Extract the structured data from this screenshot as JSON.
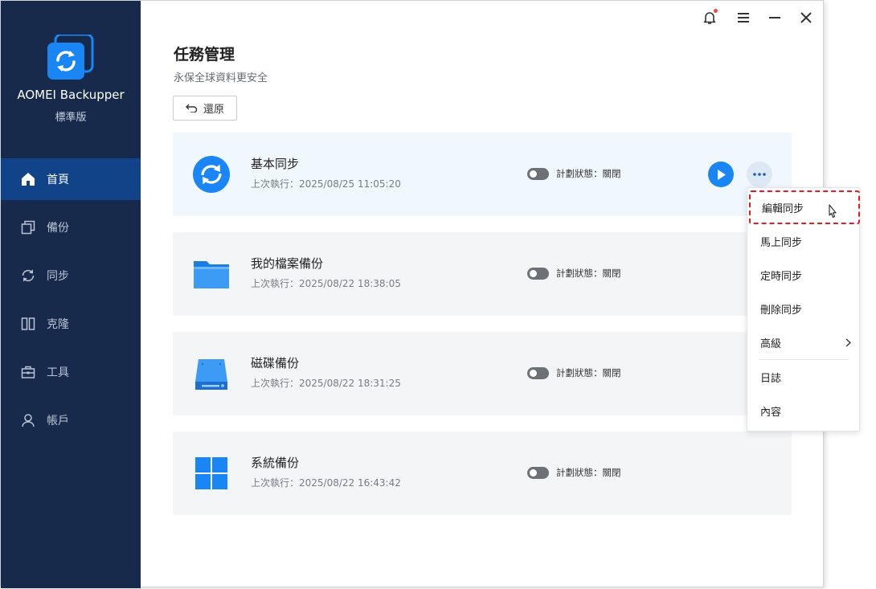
{
  "app": {
    "name": "AOMEI Backupper",
    "edition": "標準版"
  },
  "sidebar": {
    "items": [
      {
        "label": "首頁",
        "icon": "home-icon",
        "active": true
      },
      {
        "label": "備份",
        "icon": "backup-icon",
        "active": false
      },
      {
        "label": "同步",
        "icon": "sync-icon",
        "active": false
      },
      {
        "label": "克隆",
        "icon": "clone-icon",
        "active": false
      },
      {
        "label": "工具",
        "icon": "toolbox-icon",
        "active": false
      },
      {
        "label": "帳戶",
        "icon": "user-icon",
        "active": false
      }
    ]
  },
  "window_controls": [
    "bell-icon",
    "menu-icon",
    "minimize-icon",
    "close-icon"
  ],
  "header": {
    "title": "任務管理",
    "subtitle": "永保全球資料更安全",
    "restore_label": "還原"
  },
  "tasks": [
    {
      "name": "基本同步",
      "last_run": "上次執行：2025/08/25 11:05:20",
      "status": "計劃狀態：關閉",
      "icon": "sync-circle-icon",
      "selected": true
    },
    {
      "name": "我的檔案備份",
      "last_run": "上次執行：2025/08/22 18:38:05",
      "status": "計劃狀態：關閉",
      "icon": "folder-icon",
      "selected": false
    },
    {
      "name": "磁碟備份",
      "last_run": "上次執行：2025/08/22 18:31:25",
      "status": "計劃狀態：關閉",
      "icon": "disk-icon",
      "selected": false
    },
    {
      "name": "系統備份",
      "last_run": "上次執行：2025/08/22 16:43:42",
      "status": "計劃狀態：關閉",
      "icon": "windows-icon",
      "selected": false
    }
  ],
  "context_menu": {
    "items": [
      "編輯同步",
      "馬上同步",
      "定時同步",
      "刪除同步",
      "高級",
      "日誌",
      "內容"
    ],
    "highlighted": "編輯同步"
  },
  "colors": {
    "sidebar_bg": "#172a4c",
    "sidebar_active": "#114389",
    "accent": "#1a86f5",
    "highlight_border": "#e01f25"
  }
}
